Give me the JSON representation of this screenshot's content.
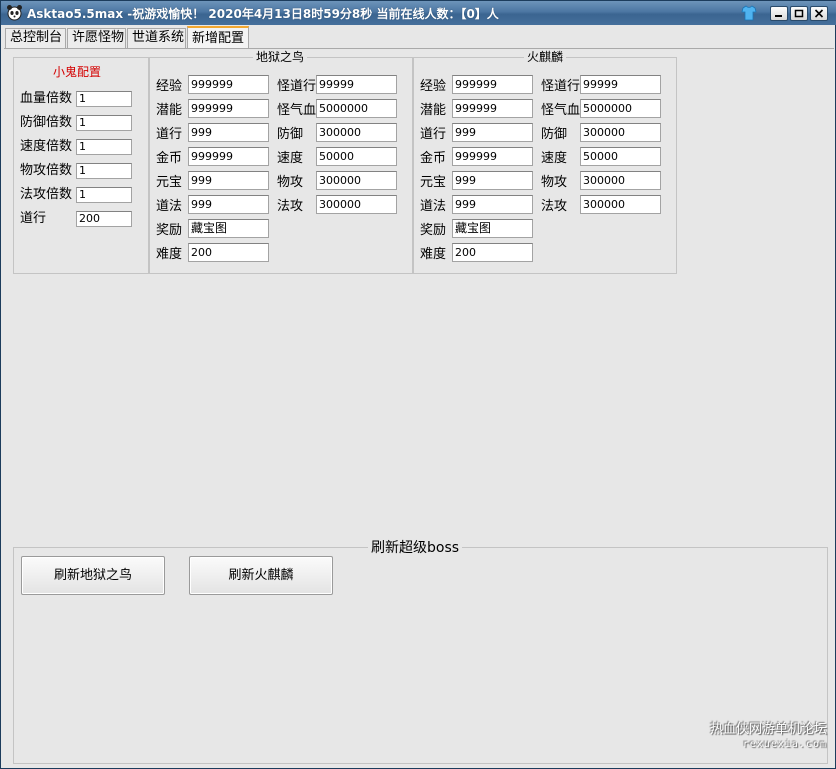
{
  "window": {
    "title": "Asktao5.5max -祝游戏愉快！ 2020年4月13日8时59分8秒 当前在线人数：【0】人"
  },
  "tabs": [
    "总控制台",
    "许愿怪物",
    "世道系统",
    "新增配置"
  ],
  "minion_config": {
    "title": "小鬼配置",
    "rows": [
      {
        "label": "血量倍数",
        "value": "1"
      },
      {
        "label": "防御倍数",
        "value": "1"
      },
      {
        "label": "速度倍数",
        "value": "1"
      },
      {
        "label": "物攻倍数",
        "value": "1"
      },
      {
        "label": "法攻倍数",
        "value": "1"
      },
      {
        "label": "道行",
        "value": "200"
      }
    ]
  },
  "hell_bird": {
    "title": "地狱之鸟",
    "left": [
      {
        "label": "经验",
        "value": "999999"
      },
      {
        "label": "潜能",
        "value": "999999"
      },
      {
        "label": "道行",
        "value": "999"
      },
      {
        "label": "金币",
        "value": "999999"
      },
      {
        "label": "元宝",
        "value": "999"
      },
      {
        "label": "道法",
        "value": "999"
      },
      {
        "label": "奖励",
        "value": "藏宝图"
      },
      {
        "label": "难度",
        "value": "200"
      }
    ],
    "right": [
      {
        "label": "怪道行",
        "value": "99999"
      },
      {
        "label": "怪气血",
        "value": "5000000"
      },
      {
        "label": "防御",
        "value": "300000"
      },
      {
        "label": "速度",
        "value": "50000"
      },
      {
        "label": "物攻",
        "value": "300000"
      },
      {
        "label": "法攻",
        "value": "300000"
      }
    ]
  },
  "fire_qilin": {
    "title": "火麒麟",
    "left": [
      {
        "label": "经验",
        "value": "999999"
      },
      {
        "label": "潜能",
        "value": "999999"
      },
      {
        "label": "道行",
        "value": "999"
      },
      {
        "label": "金币",
        "value": "999999"
      },
      {
        "label": "元宝",
        "value": "999"
      },
      {
        "label": "道法",
        "value": "999"
      },
      {
        "label": "奖励",
        "value": "藏宝图"
      },
      {
        "label": "难度",
        "value": "200"
      }
    ],
    "right": [
      {
        "label": "怪道行",
        "value": "99999"
      },
      {
        "label": "怪气血",
        "value": "5000000"
      },
      {
        "label": "防御",
        "value": "300000"
      },
      {
        "label": "速度",
        "value": "50000"
      },
      {
        "label": "物攻",
        "value": "300000"
      },
      {
        "label": "法攻",
        "value": "300000"
      }
    ]
  },
  "refresh": {
    "title": "刷新超级boss",
    "btn_bird": "刷新地狱之鸟",
    "btn_qilin": "刷新火麒麟"
  },
  "watermark": {
    "line1": "热血侠网游单机论坛",
    "line2": "rexuexia.com"
  },
  "colors": {
    "accent_tab": "#f2a72f",
    "title_red": "#d40000",
    "titlebar": "#4c76a2"
  }
}
